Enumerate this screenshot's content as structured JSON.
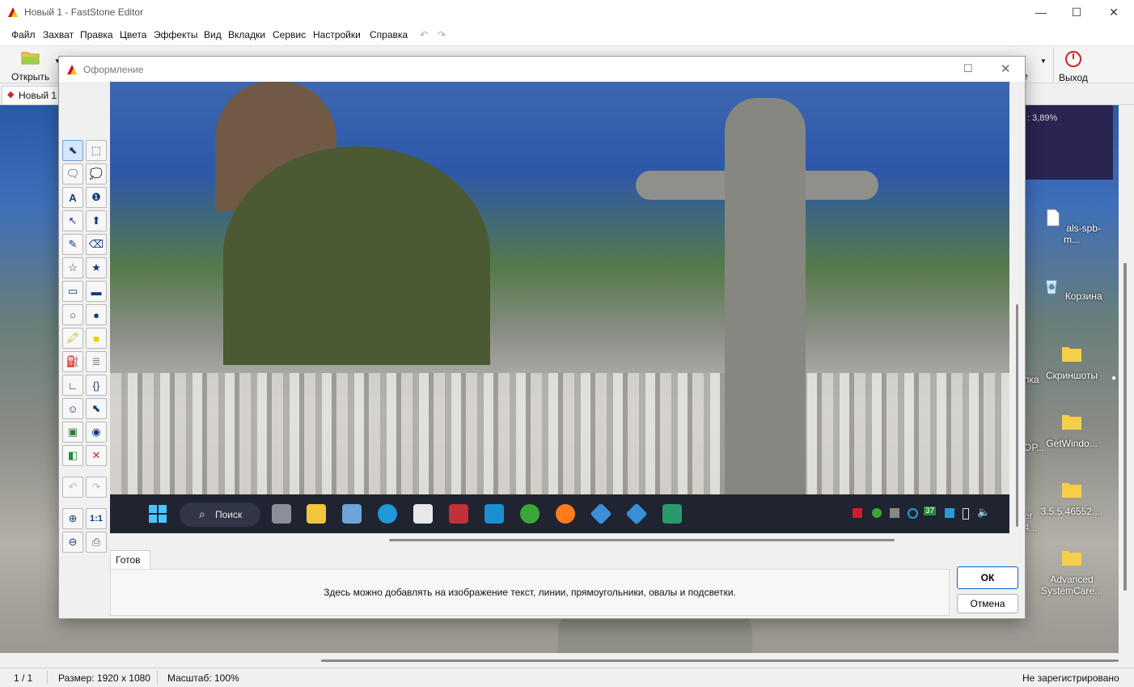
{
  "app": {
    "title": "Новый 1 - FastStone Editor",
    "window_controls": [
      "—",
      "☐",
      "✕"
    ]
  },
  "menu": [
    "Файл",
    "Захват",
    "Правка",
    "Цвета",
    "Эффекты",
    "Вид",
    "Вкладки",
    "Сервис",
    "Настройки",
    "Справка"
  ],
  "toolbar": {
    "open_label": "Открыть",
    "note_label": "ote",
    "exit_label": "Выход"
  },
  "tabs": [
    {
      "label": "Новый 1"
    }
  ],
  "desktop": {
    "stat_text": ": 3,89%",
    "icons": [
      {
        "label": "als-spb-m...",
        "icon": "file-icon"
      },
      {
        "label": "Корзина",
        "icon": "recycle-bin-icon"
      },
      {
        "label": "Скриншоты",
        "icon": "folder-icon"
      },
      {
        "label": "GetWindo...",
        "icon": "folder-icon"
      },
      {
        "label": "3.5.5.46552....",
        "icon": "folder-icon"
      },
      {
        "label": "Advanced SystemCare...",
        "icon": "folder-icon"
      }
    ],
    "partial_labels": [
      "пка",
      "ОР...",
      "er",
      "4..."
    ]
  },
  "dialog": {
    "title": "Оформление",
    "tab_label": "Готов",
    "info_text": "Здесь можно добавлять на изображение текст, линии, прямоугольники, овалы и подсветки.",
    "ok_label": "ОК",
    "cancel_label": "Отмена",
    "taskbar": {
      "search_label": "Поиск",
      "tray_badge": "37"
    }
  },
  "status": {
    "pages": "1 / 1",
    "size": "Размер: 1920 x 1080",
    "zoom": "Масштаб: 100%",
    "registration": "Не зарегистрировано"
  },
  "colors": {
    "accent": "#0a64c8",
    "taskbar": "#1f2430",
    "exit_red": "#d4202a"
  }
}
